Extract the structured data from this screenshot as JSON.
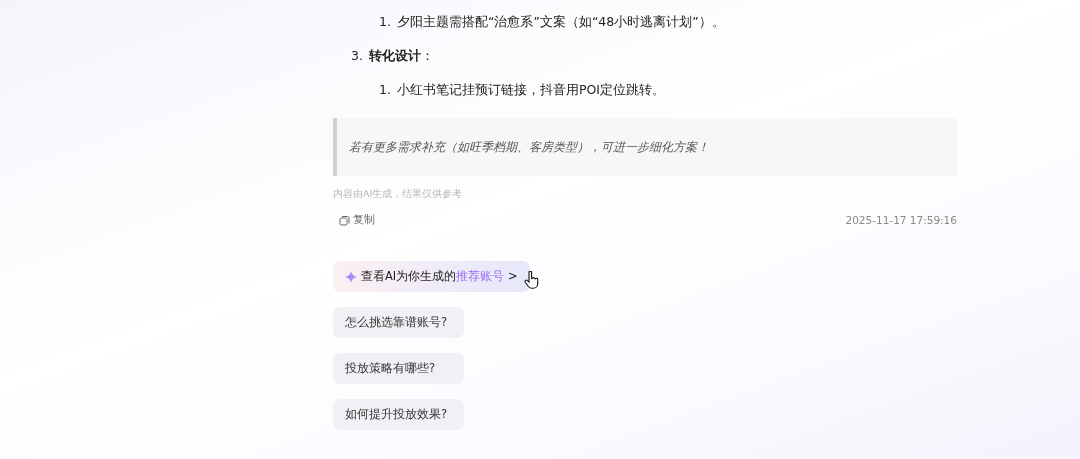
{
  "list": [
    {
      "children": [
        {
          "number": "1.",
          "text": "夕阳主题需搭配“治愈系”文案（如“48小时逃离计划”）。"
        }
      ]
    },
    {
      "number": "3.",
      "text": "**转化设计**：",
      "children": [
        {
          "number": "1.",
          "text": "小红书笔记挂预订链接，抖音用POI定位跳转。"
        }
      ]
    }
  ],
  "quote": "若有更多需求补充（如旺季档期、客房类型），可进一步细化方案！",
  "disclaimer": "内容由AI生成，结果仅供参考",
  "copy_label": "复制",
  "timestamp": "2025-11-17 17:59:16",
  "recommend": {
    "prefix": "查看AI为你生成的",
    "highlight": "推荐账号",
    "arrow": ">"
  },
  "suggestions": [
    "怎么挑选靠谱账号?",
    "投放策略有哪些?",
    "如何提升投放效果?"
  ]
}
